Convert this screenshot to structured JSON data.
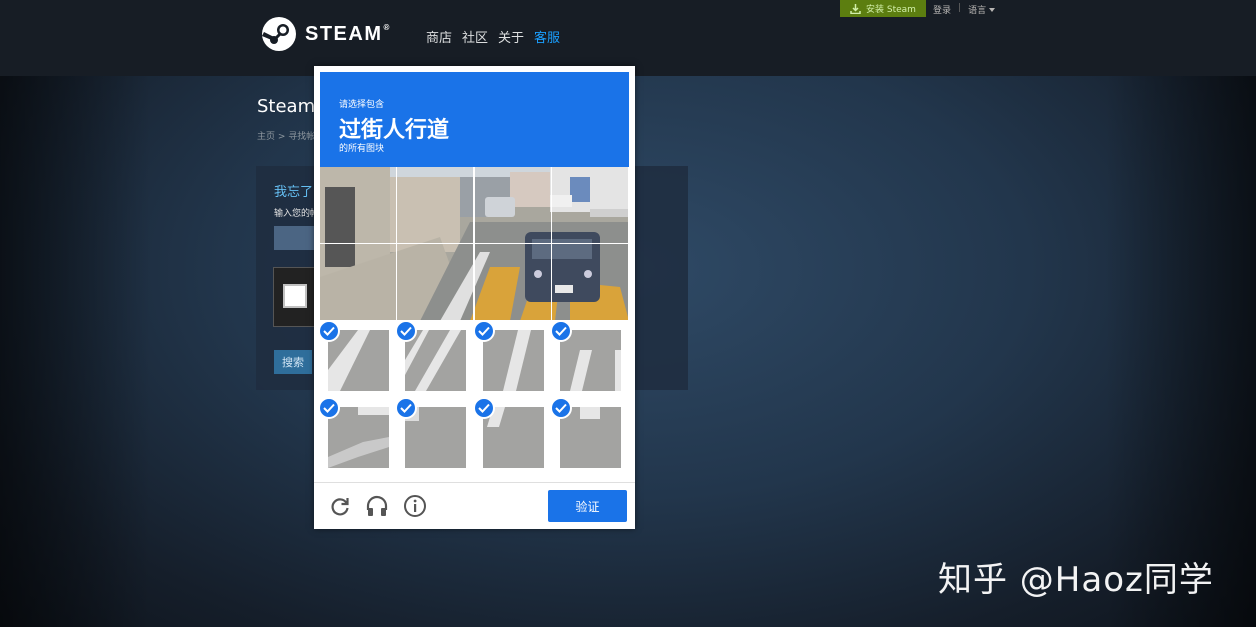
{
  "header": {
    "logo_text": "STEAM",
    "logo_mark": "®",
    "nav": [
      "商店",
      "社区",
      "关于",
      "客服"
    ],
    "active_nav": 3,
    "install_label": "安装 Steam",
    "login_label": "登录",
    "separator": "|",
    "language_label": "语言"
  },
  "page": {
    "title": "Steam",
    "breadcrumb": "主页 > 寻找帐",
    "panel_title": "我忘了",
    "panel_label": "输入您的帐",
    "search_label": "搜索"
  },
  "captcha": {
    "instruction_line1": "请选择包含",
    "instruction_keyword": "过街人行道",
    "instruction_line3": "的所有图块",
    "verify_label": "验证",
    "reload_icon": "reload-icon",
    "audio_icon": "headphones-icon",
    "info_icon": "info-icon",
    "accent_color": "#1a73e8",
    "tiles_selected": [
      false,
      false,
      false,
      false,
      false,
      false,
      false,
      false,
      true,
      true,
      true,
      true,
      true,
      true,
      true,
      true
    ]
  },
  "colors": {
    "header_bg": "#171d25",
    "install_bg": "#5c7e10",
    "nav_active": "#1a9fff"
  },
  "watermark": "知乎 @Haoz同学"
}
